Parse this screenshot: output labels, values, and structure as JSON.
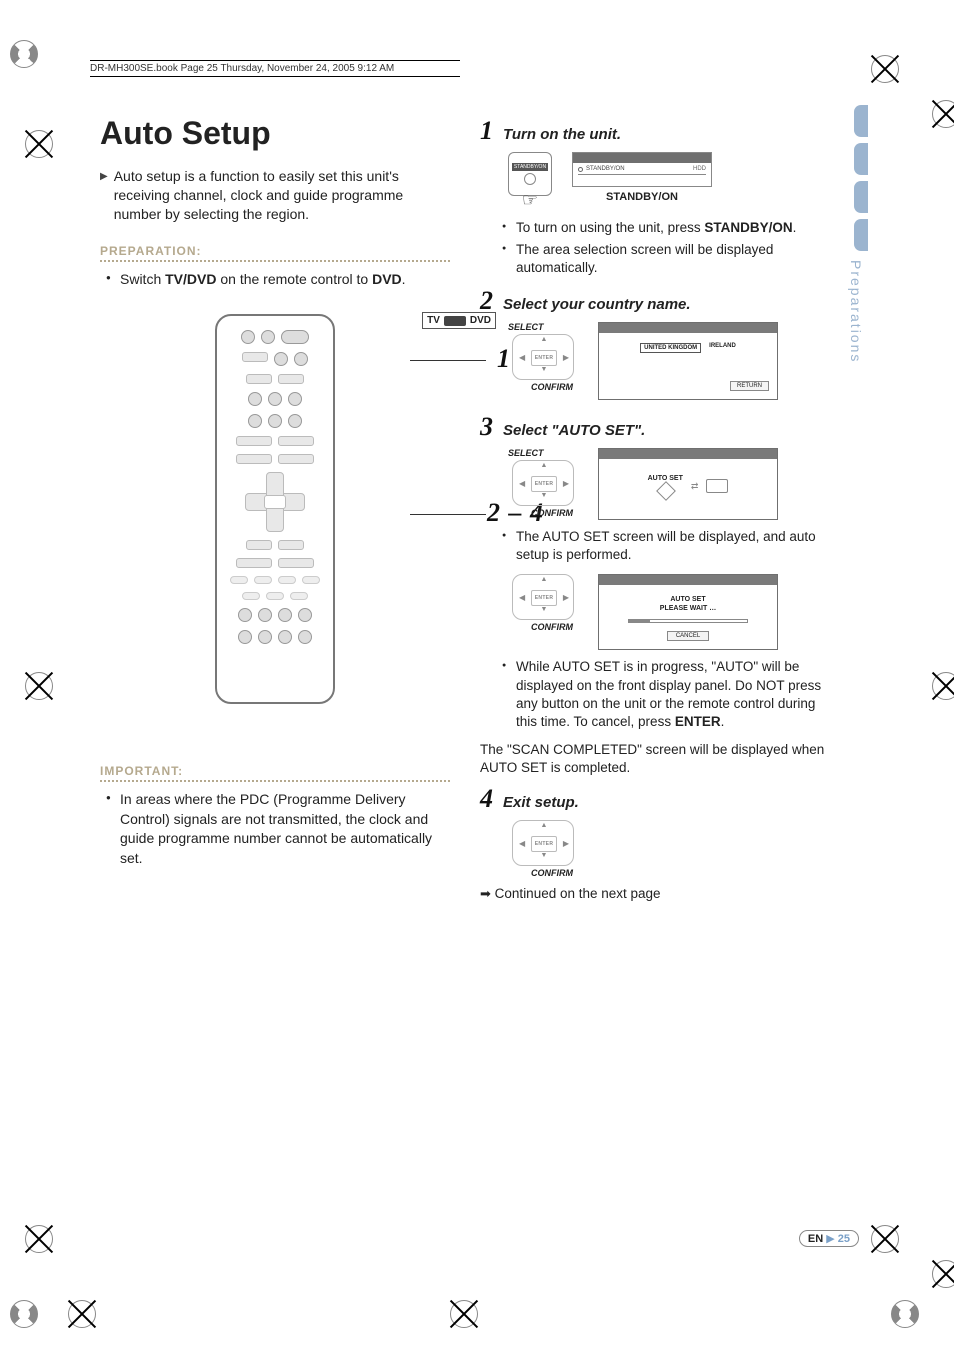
{
  "header": {
    "running_head": "DR-MH300SE.book  Page 25  Thursday, November 24, 2005  9:12 AM"
  },
  "side": {
    "section": "Preparations"
  },
  "footer": {
    "lang": "EN",
    "page": "25"
  },
  "left": {
    "title": "Auto Setup",
    "intro": "Auto setup is a function to easily set this unit's receiving channel, clock and guide programme number by selecting the region.",
    "preparation_label": "PREPARATION:",
    "preparation_item_pre": "Switch ",
    "preparation_item_b1": "TV/DVD",
    "preparation_item_mid": " on the remote control to ",
    "preparation_item_b2": "DVD",
    "preparation_item_post": ".",
    "remote_callout": {
      "tv": "TV",
      "dvd": "DVD"
    },
    "callouts": {
      "one": "1",
      "range": "2 – 4"
    },
    "important_label": "IMPORTANT:",
    "important_item": "In areas where the PDC (Programme Delivery Control) signals are not transmitted, the clock and guide programme number cannot be automatically set."
  },
  "right": {
    "step1": {
      "num": "1",
      "title": "Turn on the unit.",
      "standby_label": "STANDBY/ON",
      "panel_standby": "STANDBY/ON",
      "panel_hdd": "HDD",
      "caption": "STANDBY/ON",
      "b1_pre": "To turn on using the unit, press ",
      "b1_b": "STANDBY/ON",
      "b1_post": ".",
      "b2": "The area selection screen will be displayed automatically."
    },
    "step2": {
      "num": "2",
      "title": "Select your country name.",
      "select": "SELECT",
      "enter": "ENTER",
      "confirm": "CONFIRM",
      "opt1": "UNITED KINGDOM",
      "opt2": "IRELAND",
      "return": "RETURN"
    },
    "step3": {
      "num": "3",
      "title": "Select \"AUTO SET\".",
      "select": "SELECT",
      "enter": "ENTER",
      "confirm": "CONFIRM",
      "auto_set": "AUTO SET",
      "b1": "The AUTO SET screen will be displayed, and auto setup is performed.",
      "wait_l1": "AUTO SET",
      "wait_l2": "PLEASE WAIT …",
      "cancel": "CANCEL",
      "b2_pre": "While AUTO SET is in progress, \"AUTO\" will be displayed on the front display panel. Do NOT press any button on the unit or the remote control during this time. To cancel, press ",
      "b2_b": "ENTER",
      "b2_post": "."
    },
    "scan_complete": "The \"SCAN COMPLETED\" screen will be displayed when AUTO SET is completed.",
    "step4": {
      "num": "4",
      "title": "Exit setup.",
      "enter": "ENTER",
      "confirm": "CONFIRM"
    },
    "continued": "Continued on the next page"
  }
}
